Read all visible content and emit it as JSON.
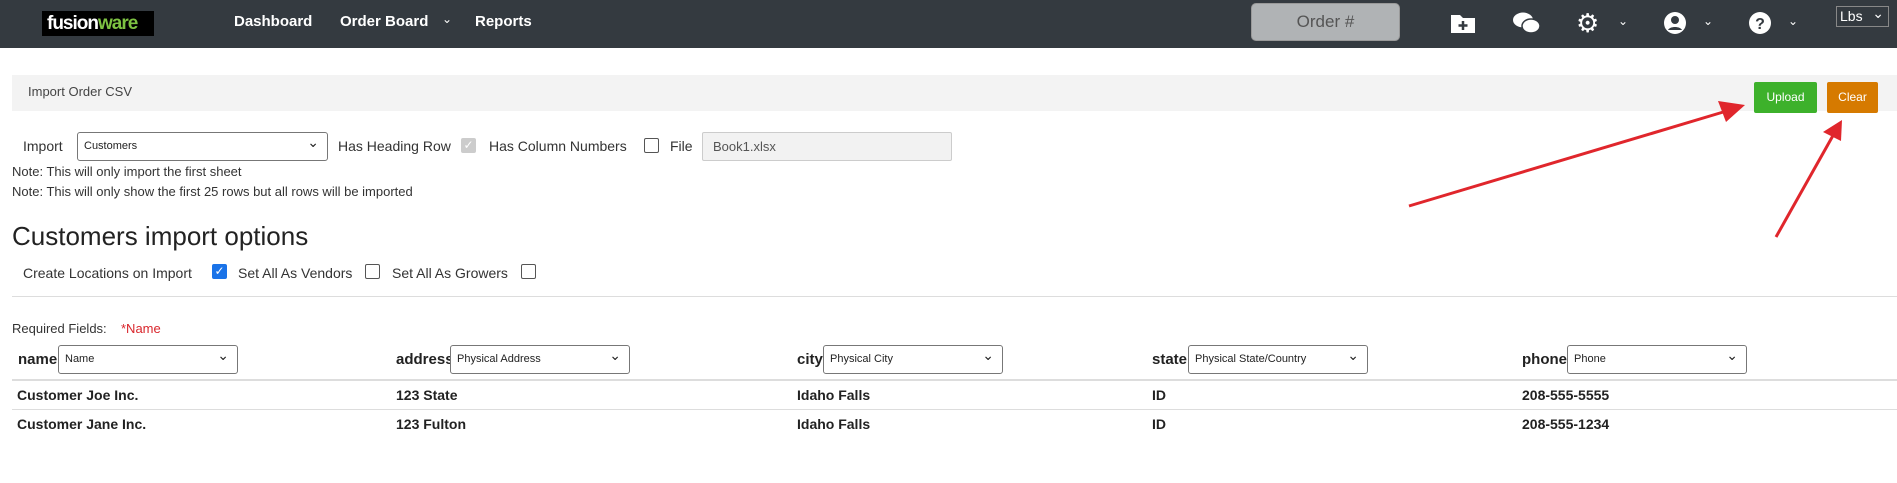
{
  "nav": {
    "logo_a": "fusion",
    "logo_b": "ware",
    "links": [
      "Dashboard",
      "Order Board",
      "Reports"
    ],
    "order_placeholder": "Order #",
    "unit": "Lbs"
  },
  "panel": {
    "title": "Import Order CSV",
    "upload": "Upload",
    "clear": "Clear"
  },
  "form": {
    "import_label": "Import",
    "import_value": "Customers",
    "heading_row": "Has Heading Row",
    "column_numbers": "Has Column Numbers",
    "file_label": "File",
    "file_value": "Book1.xlsx",
    "note1": "Note: This will only import the first sheet",
    "note2": "Note: This will only show the first 25 rows but all rows will be imported"
  },
  "options": {
    "title": "Customers import options",
    "create_locations": "Create Locations on Import",
    "vendors": "Set All As Vendors",
    "growers": "Set All As Growers"
  },
  "required": {
    "label": "Required Fields:",
    "fields": "*Name"
  },
  "columns": [
    {
      "name": "name",
      "mapping": "Name"
    },
    {
      "name": "address",
      "mapping": "Physical Address"
    },
    {
      "name": "city",
      "mapping": "Physical City"
    },
    {
      "name": "state",
      "mapping": "Physical State/Country"
    },
    {
      "name": "phone",
      "mapping": "Phone"
    }
  ],
  "rows": [
    [
      "Customer Joe Inc.",
      "123 State",
      "Idaho Falls",
      "ID",
      "208-555-5555"
    ],
    [
      "Customer Jane Inc.",
      "123 Fulton",
      "Idaho Falls",
      "ID",
      "208-555-1234"
    ]
  ],
  "colors": {
    "nav": "#343a40",
    "upload": "#3db12b",
    "clear": "#d67a00",
    "required": "#d9262c",
    "arrow": "#e0262c"
  }
}
